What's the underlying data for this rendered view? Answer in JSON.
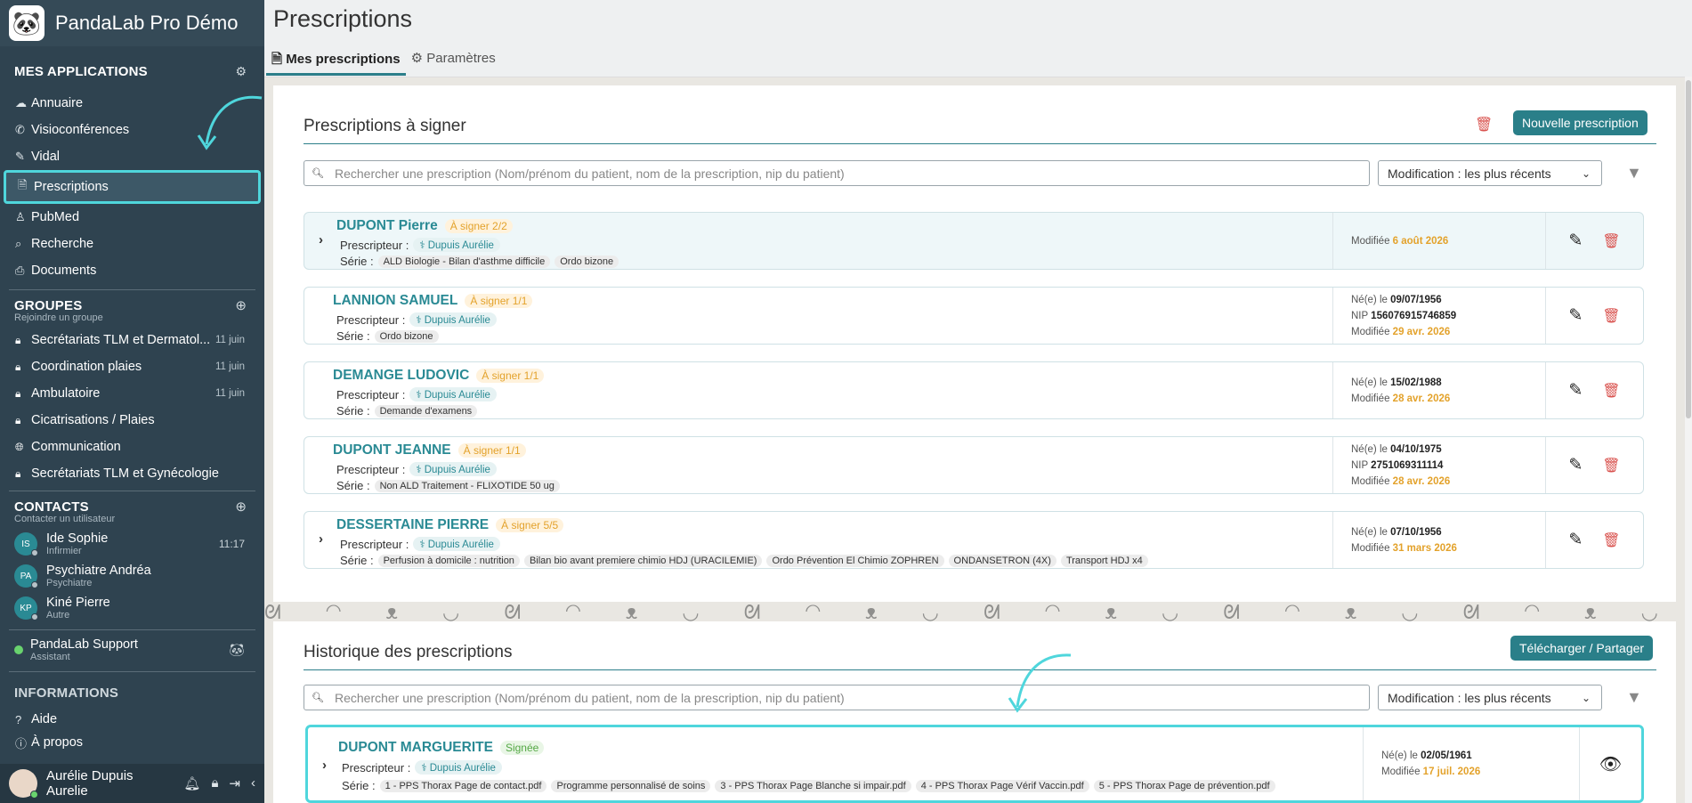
{
  "app": {
    "name": "PandaLab Pro Démo",
    "logo": "🐼"
  },
  "sidebar": {
    "apps_title": "MES APPLICATIONS",
    "apps": [
      {
        "icon": "☁",
        "label": "Annuaire"
      },
      {
        "icon": "✆",
        "label": "Visioconférences"
      },
      {
        "icon": "✎",
        "label": "Vidal"
      },
      {
        "icon": "🗎",
        "label": "Prescriptions"
      },
      {
        "icon": "♙",
        "label": "PubMed"
      },
      {
        "icon": "⌕",
        "label": "Recherche"
      },
      {
        "icon": "⎙",
        "label": "Documents"
      }
    ],
    "groups_title": "GROUPES",
    "groups_sub": "Rejoindre un groupe",
    "groups": [
      {
        "label": "Secrétariats TLM et Dermatol...",
        "date": "11 juin"
      },
      {
        "label": "Coordination plaies",
        "date": "11 juin"
      },
      {
        "label": "Ambulatoire",
        "date": "11 juin"
      },
      {
        "label": "Cicatrisations / Plaies",
        "date": ""
      },
      {
        "label": "Communication",
        "date": ""
      },
      {
        "label": "Secrétariats TLM et Gynécologie",
        "date": ""
      }
    ],
    "contacts_title": "CONTACTS",
    "contacts_sub": "Contacter un utilisateur",
    "contacts": [
      {
        "initials": "IS",
        "name": "Ide Sophie",
        "role": "Infirmier",
        "time": "11:17"
      },
      {
        "initials": "PA",
        "name": "Psychiatre Andréa",
        "role": "Psychiatre",
        "time": ""
      },
      {
        "initials": "KP",
        "name": "Kiné Pierre",
        "role": "Autre",
        "time": ""
      }
    ],
    "support": {
      "name": "PandaLab Support",
      "role": "Assistant"
    },
    "info_title": "INFORMATIONS",
    "info": [
      {
        "icon": "?",
        "label": "Aide"
      },
      {
        "icon": "ⓘ",
        "label": "À propos"
      }
    ],
    "user": {
      "name": "Aurélie Dupuis",
      "sub": "Aurelie"
    }
  },
  "page": {
    "title": "Prescriptions",
    "tabs": [
      {
        "icon": "🗎",
        "label": "Mes prescriptions"
      },
      {
        "icon": "⚙",
        "label": "Paramètres"
      }
    ]
  },
  "to_sign": {
    "title": "Prescriptions à signer",
    "new_button": "Nouvelle prescription",
    "search_placeholder": "Rechercher une prescription (Nom/prénom du patient, nom de la prescription, nip du patient)",
    "sort": "Modification : les plus récents",
    "labels": {
      "prescriber": "Prescripteur :",
      "series": "Série :",
      "born": "Né(e) le",
      "nip": "NIP",
      "modified": "Modifiée"
    },
    "items": [
      {
        "patient": "DUPONT Pierre",
        "status": "À signer 2/2",
        "doctor": "Dupuis Aurélie",
        "series": [
          "ALD Biologie - Bilan d'asthme difficile",
          "Ordo bizone"
        ],
        "born": "",
        "nip": "",
        "modified": "6 août 2026",
        "expandable": true
      },
      {
        "patient": "LANNION SAMUEL",
        "status": "À signer 1/1",
        "doctor": "Dupuis Aurélie",
        "series": [
          "Ordo bizone"
        ],
        "born": "09/07/1956",
        "nip": "156076915746859",
        "modified": "29 avr. 2026",
        "expandable": false
      },
      {
        "patient": "DEMANGE LUDOVIC",
        "status": "À signer 1/1",
        "doctor": "Dupuis Aurélie",
        "series": [
          "Demande d'examens"
        ],
        "born": "15/02/1988",
        "nip": "",
        "modified": "28 avr. 2026",
        "expandable": false
      },
      {
        "patient": "DUPONT JEANNE",
        "status": "À signer 1/1",
        "doctor": "Dupuis Aurélie",
        "series": [
          "Non ALD Traitement - FLIXOTIDE 50 ug"
        ],
        "born": "04/10/1975",
        "nip": "2751069311114",
        "modified": "28 avr. 2026",
        "expandable": false
      },
      {
        "patient": "DESSERTAINE PIERRE",
        "status": "À signer 5/5",
        "doctor": "Dupuis Aurélie",
        "series": [
          "Perfusion à domicile : nutrition",
          "Bilan bio avant premiere chimio HDJ (URACILEMIE)",
          "Ordo Prévention El Chimio ZOPHREN",
          "ONDANSETRON (4X)",
          "Transport HDJ x4"
        ],
        "born": "07/10/1956",
        "nip": "",
        "modified": "31 mars 2026",
        "expandable": true
      }
    ]
  },
  "history": {
    "title": "Historique des prescriptions",
    "share_button": "Télécharger / Partager",
    "search_placeholder": "Rechercher une prescription (Nom/prénom du patient, nom de la prescription, nip du patient)",
    "sort": "Modification : les plus récents",
    "items": [
      {
        "patient": "DUPONT MARGUERITE",
        "status": "Signée",
        "doctor": "Dupuis Aurélie",
        "series": [
          "1 - PPS Thorax Page de contact.pdf",
          "Programme personnalisé de soins",
          "3 - PPS Thorax Page Blanche si impair.pdf",
          "4 - PPS Thorax Page Vérif Vaccin.pdf",
          "5 - PPS Thorax Page de prévention.pdf"
        ],
        "born": "02/05/1961",
        "modified": "17 juil. 2026"
      }
    ]
  },
  "colors": {
    "accent": "#2a7f89",
    "highlight": "#4fd6dc",
    "sidebar": "#2f4350",
    "pending": "#e3a22b",
    "danger": "#d9534f"
  }
}
